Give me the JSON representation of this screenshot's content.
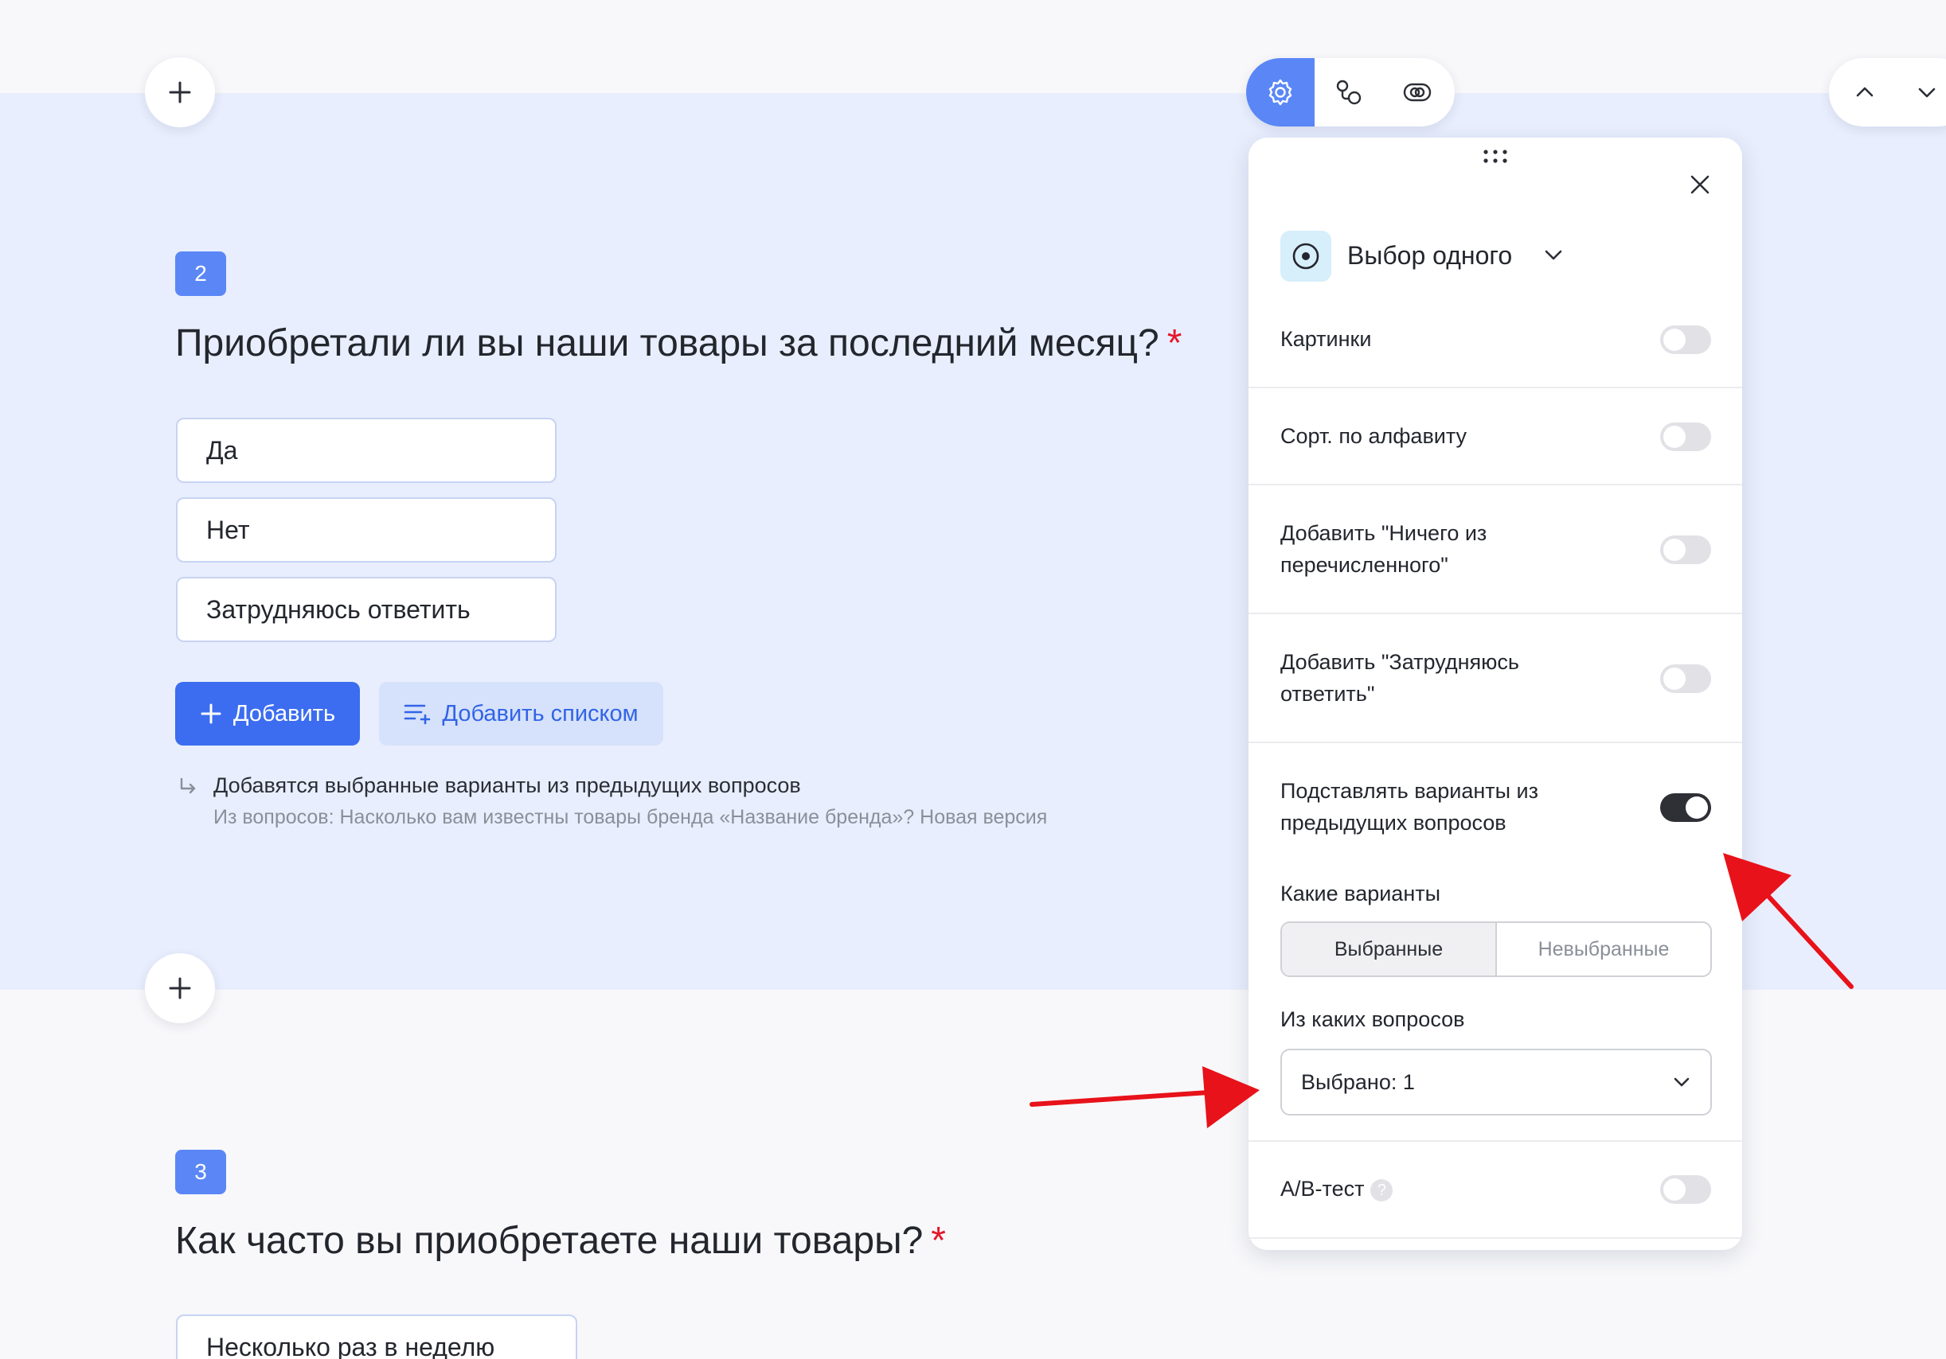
{
  "question2": {
    "number": "2",
    "title": "Приобретали ли вы наши товары за последний месяц?",
    "required_mark": "*",
    "answers": [
      "Да",
      "Нет",
      "Затрудняюсь ответить"
    ],
    "add_button": "Добавить",
    "add_list_button": "Добавить списком",
    "note_title": "Добавятся выбранные варианты из предыдущих вопросов",
    "note_sub": "Из вопросов: Насколько вам известны товары бренда «Название бренда»? Новая версия"
  },
  "question3": {
    "number": "3",
    "title": "Как часто вы приобретаете наши товары?",
    "required_mark": "*",
    "answers": [
      "Несколько раз в неделю"
    ]
  },
  "toolbar": {
    "items": [
      {
        "icon": "gear-icon",
        "active": true
      },
      {
        "icon": "logic-icon",
        "active": false
      },
      {
        "icon": "visibility-icon",
        "active": false
      }
    ]
  },
  "panel": {
    "type_label": "Выбор одного",
    "rows": {
      "images": {
        "label": "Картинки",
        "on": false
      },
      "sort": {
        "label": "Сорт. по алфавиту",
        "on": false
      },
      "none_option": {
        "label_line1": "Добавить \"Ничего из",
        "label_line2": "перечисленного\"",
        "on": false
      },
      "hard_option": {
        "label_line1": "Добавить \"Затрудняюсь",
        "label_line2": "ответить\"",
        "on": false
      },
      "carry_forward": {
        "label_line1": "Подставлять варианты из",
        "label_line2": "предыдущих вопросов",
        "on": true
      },
      "ab_test": {
        "label": "A/B-тест",
        "help": "?",
        "on": false
      }
    },
    "which_variants_label": "Какие варианты",
    "segments": [
      "Выбранные",
      "Невыбранные"
    ],
    "selected_segment": "Выбранные",
    "from_questions_label": "Из каких вопросов",
    "from_questions_value": "Выбрано: 1"
  },
  "colors": {
    "accent": "#3c6df0",
    "band": "#e8eefd",
    "required": "#e4172b",
    "annotation": "#e8121a"
  }
}
